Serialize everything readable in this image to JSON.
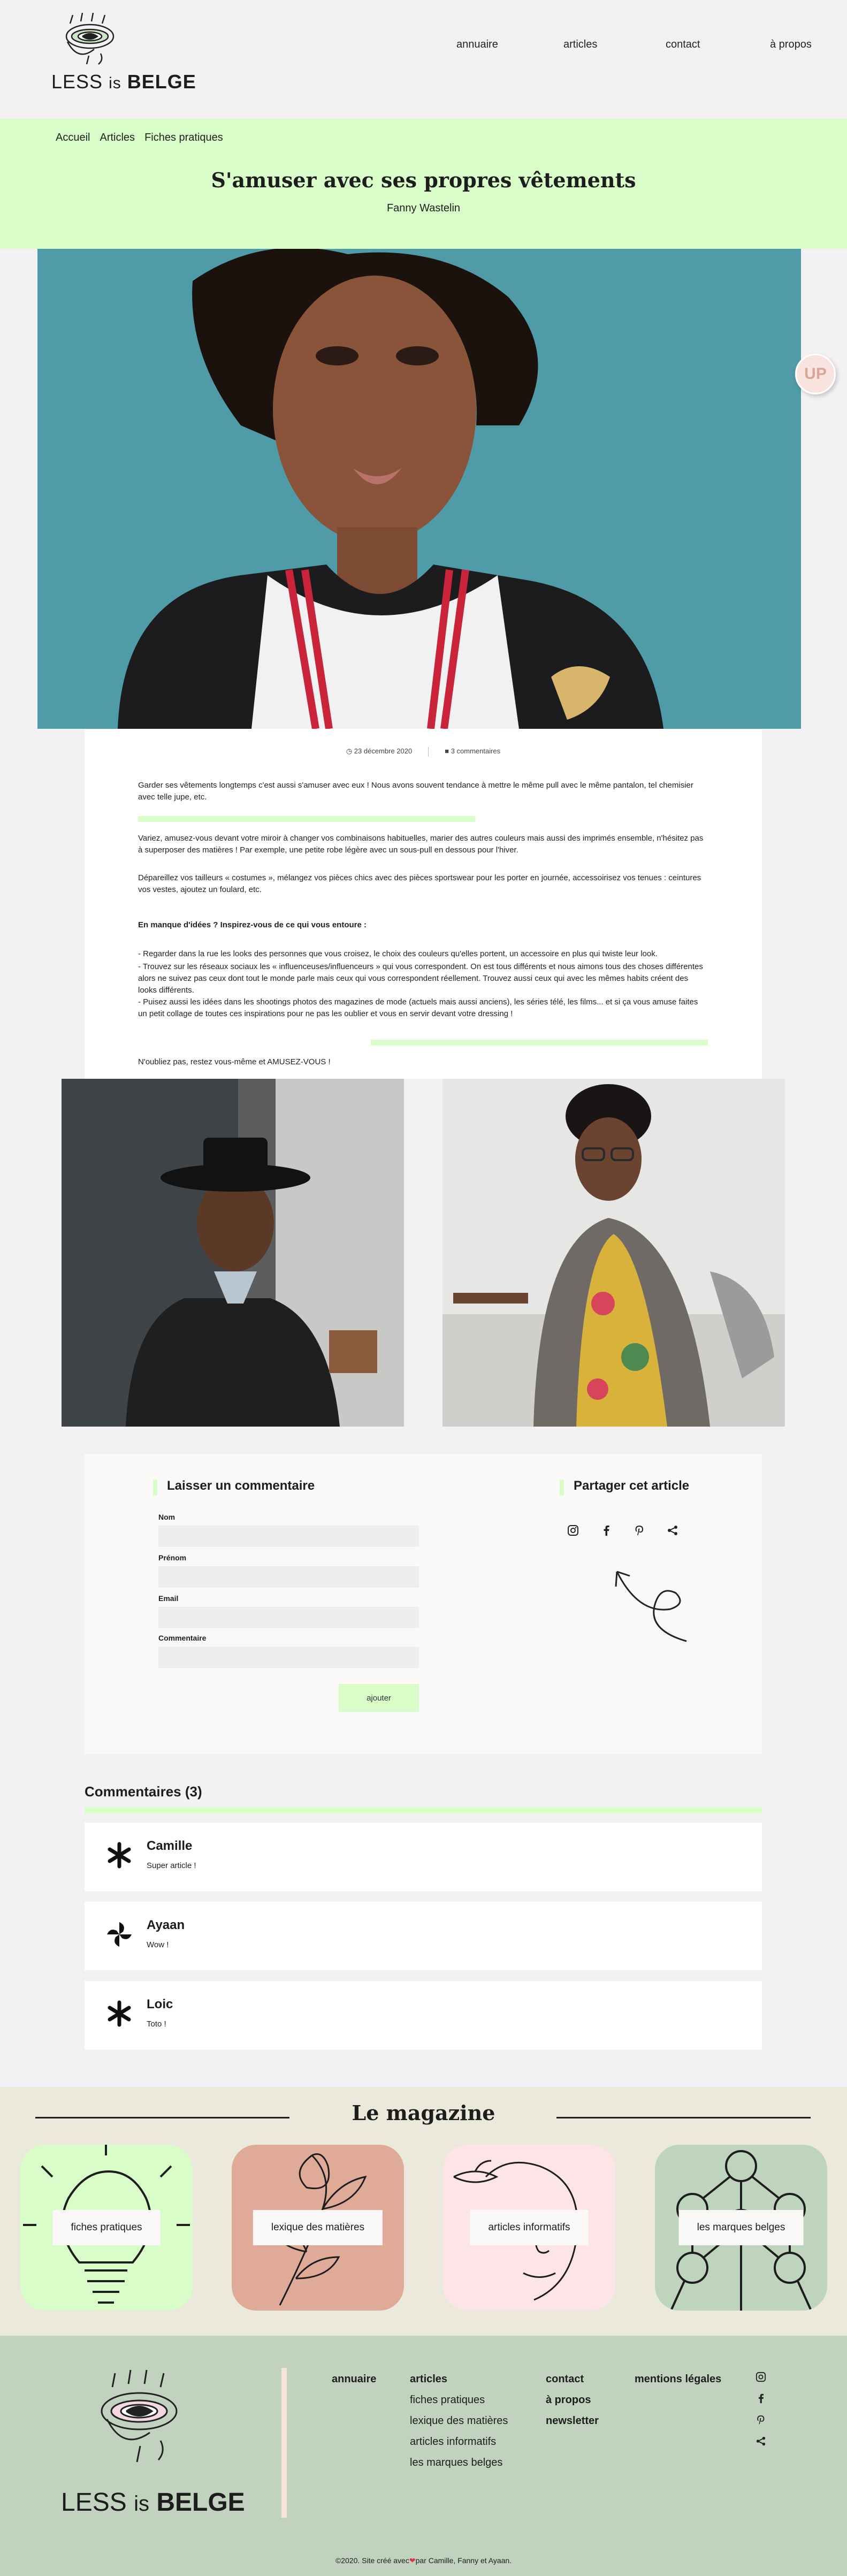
{
  "logo": {
    "less": "LESS",
    "is": "is",
    "belge": "BELGE"
  },
  "nav": [
    {
      "label": "annuaire"
    },
    {
      "label": "articles"
    },
    {
      "label": "contact"
    },
    {
      "label": "à propos"
    }
  ],
  "breadcrumb": [
    "Accueil",
    "Articles",
    "Fiches pratiques"
  ],
  "article": {
    "title": "S'amuser avec ses propres vêtements",
    "author": "Fanny Wastelin",
    "date": "23 décembre 2020",
    "comments_meta": "3 commentaires",
    "up_label": "UP",
    "p1": "Garder ses vêtements longtemps c'est aussi s'amuser avec eux ! Nous avons souvent tendance à mettre le même pull avec le même pantalon, tel chemisier avec telle jupe, etc.",
    "p2": "Variez, amusez-vous devant votre miroir à changer vos combinaisons habituelles, marier des autres couleurs mais aussi des imprimés ensemble, n'hésitez pas à superposer des matières ! Par exemple, une petite robe légère avec un sous-pull en dessous pour l'hiver.",
    "p3": "Dépareillez vos tailleurs « costumes », mélangez vos pièces chics avec des pièces sportswear pour les porter en journée, accessoirisez vos tenues : ceintures vos vestes, ajoutez un foulard, etc.",
    "p4_heading": "En manque d'idées ? Inspirez-vous de ce qui vous entoure :",
    "p4_lines": [
      "- Regarder dans la rue les looks des personnes que vous croisez, le choix des couleurs qu'elles portent, un accessoire en plus qui twiste leur look.",
      "- Trouvez sur les réseaux sociaux les « influenceuses/influenceurs » qui vous correspondent. On est tous différents et nous aimons tous des choses différentes alors ne suivez pas ceux dont tout le monde parle mais ceux qui vous correspondent réellement. Trouvez aussi ceux qui avec les mêmes habits créent des looks différents.",
      "- Puisez aussi les idées dans les shootings photos des magazines de mode (actuels mais aussi anciens), les séries télé, les films... et si ça vous amuse faites un petit collage de toutes ces inspirations pour ne pas les oublier et vous en servir devant votre dressing !"
    ],
    "closing": "N'oubliez pas, restez vous-même et AMUSEZ-VOUS !"
  },
  "comment_form": {
    "heading": "Laisser un commentaire",
    "labels": [
      "Nom",
      "Prénom",
      "Email",
      "Commentaire"
    ],
    "submit": "ajouter"
  },
  "share": {
    "heading": "Partager cet article",
    "icons": [
      "instagram-icon",
      "facebook-icon",
      "pinterest-icon",
      "share-icon"
    ]
  },
  "comments": {
    "title": "Commentaires (3)",
    "items": [
      {
        "name": "Camille",
        "text": "Super article !",
        "icon": "asterisk-icon"
      },
      {
        "name": "Ayaan",
        "text": "Wow !",
        "icon": "pinwheel-icon"
      },
      {
        "name": "Loic",
        "text": "Toto !",
        "icon": "asterisk-icon"
      }
    ]
  },
  "magazine": {
    "title": "Le magazine",
    "cards": [
      {
        "label": "fiches pratiques",
        "color": "#d8fdc8"
      },
      {
        "label": "lexique des matières",
        "color": "#dfaa98"
      },
      {
        "label": "articles informatifs",
        "color": "#fde4e6"
      },
      {
        "label": "les marques belges",
        "color": "#bfd4bd"
      }
    ]
  },
  "footer": {
    "col1": [
      "annuaire"
    ],
    "col2_head": "articles",
    "col2": [
      "fiches pratiques",
      "lexique des matières",
      "articles informatifs",
      "les marques belges"
    ],
    "col3": [
      "contact",
      "à propos",
      "newsletter"
    ],
    "col4": [
      "mentions légales"
    ],
    "copyright_before": "©2020. Site créé avec",
    "copyright_after": "par Camille, Fanny et Ayaan."
  },
  "colors": {
    "accent_green": "#d8fdc8",
    "footer_bg": "#c1d2bf",
    "magazine_bg": "#ebe9db",
    "page_bg": "#f3f1f4"
  }
}
